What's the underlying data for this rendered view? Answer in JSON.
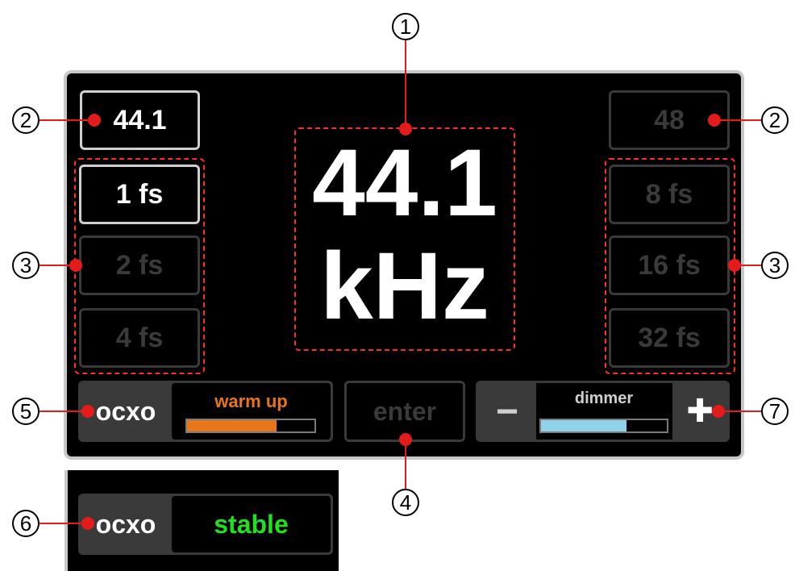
{
  "display": {
    "rate": "44.1",
    "unit": "kHz"
  },
  "base_rates": {
    "left": "44.1",
    "right": "48"
  },
  "multipliers": {
    "left": [
      "1 fs",
      "2 fs",
      "4 fs"
    ],
    "right": [
      "8 fs",
      "16 fs",
      "32 fs"
    ]
  },
  "ocxo": {
    "label": "ocxo",
    "warmup_label": "warm up",
    "warmup_progress": 0.7,
    "stable_label": "stable"
  },
  "enter_label": "enter",
  "dimmer": {
    "label": "dimmer",
    "minus": "−",
    "plus": "✚",
    "level": 0.68
  },
  "callouts": [
    "1",
    "2",
    "2",
    "3",
    "3",
    "4",
    "5",
    "6",
    "7"
  ],
  "colors": {
    "callout": "#e41b1b",
    "warmup": "#e8751a",
    "stable": "#21e021",
    "dimmer_bar": "#8fd3e8",
    "active_border": "#cfcfcf",
    "inactive": "#3a3a3a"
  }
}
